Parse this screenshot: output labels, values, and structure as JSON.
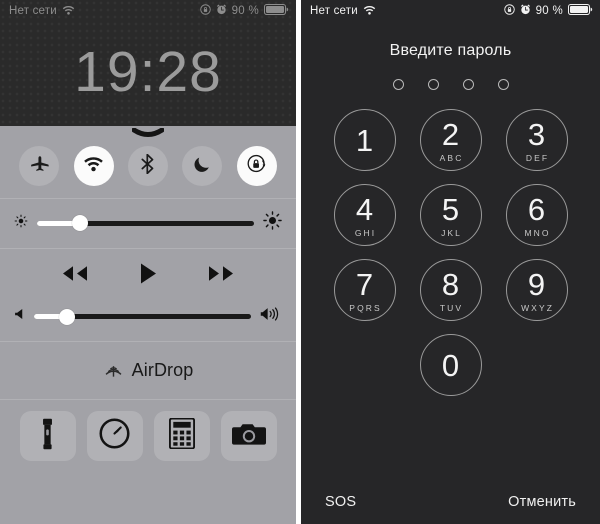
{
  "left": {
    "status_bar": {
      "carrier": "Нет сети",
      "wifi_icon": "wifi-icon",
      "rotation_lock_icon": "rotation-lock-icon",
      "alarm_icon": "alarm-clock-icon",
      "battery_percent": "90 %",
      "battery_icon": "battery-icon",
      "text_color": "#8d8d8d"
    },
    "clock": "19:28",
    "grabber_icon": "chevron-down-grabber-icon",
    "toggles": [
      {
        "name": "airplane-mode",
        "icon": "airplane-icon",
        "state": "off"
      },
      {
        "name": "wifi",
        "icon": "wifi-icon",
        "state": "on"
      },
      {
        "name": "bluetooth",
        "icon": "bluetooth-icon",
        "state": "off"
      },
      {
        "name": "do-not-disturb",
        "icon": "moon-icon",
        "state": "off"
      },
      {
        "name": "rotation-lock",
        "icon": "rotation-lock-icon",
        "state": "on"
      }
    ],
    "brightness": {
      "value_percent": 20,
      "low_icon": "sun-small-icon",
      "high_icon": "sun-large-icon"
    },
    "media": {
      "rewind_icon": "rewind-icon",
      "play_icon": "play-icon",
      "forward_icon": "fast-forward-icon"
    },
    "volume": {
      "value_percent": 15,
      "mute_icon": "speaker-low-icon",
      "max_icon": "speaker-high-icon"
    },
    "airdrop": {
      "label": "AirDrop",
      "icon": "airdrop-icon"
    },
    "shortcuts": [
      {
        "name": "flashlight",
        "icon": "flashlight-icon"
      },
      {
        "name": "timer",
        "icon": "timer-icon"
      },
      {
        "name": "calculator",
        "icon": "calculator-icon"
      },
      {
        "name": "camera",
        "icon": "camera-icon"
      }
    ],
    "colors": {
      "panel_bg": "#a2a2a7",
      "wallpaper_bg": "#2a2a2a",
      "slider_track": "#191919"
    }
  },
  "right": {
    "status_bar": {
      "carrier": "Нет сети",
      "wifi_icon": "wifi-icon",
      "rotation_lock_icon": "rotation-lock-icon",
      "alarm_icon": "alarm-clock-icon",
      "battery_percent": "90 %",
      "battery_icon": "battery-icon",
      "text_color": "#f2f2f2"
    },
    "title": "Введите пароль",
    "passcode_dots": {
      "total": 4,
      "filled": 0
    },
    "keypad": [
      {
        "num": "1",
        "letters": ""
      },
      {
        "num": "2",
        "letters": "ABC"
      },
      {
        "num": "3",
        "letters": "DEF"
      },
      {
        "num": "4",
        "letters": "GHI"
      },
      {
        "num": "5",
        "letters": "JKL"
      },
      {
        "num": "6",
        "letters": "MNO"
      },
      {
        "num": "7",
        "letters": "PQRS"
      },
      {
        "num": "8",
        "letters": "TUV"
      },
      {
        "num": "9",
        "letters": "WXYZ"
      },
      {
        "num": "0",
        "letters": ""
      }
    ],
    "sos_label": "SOS",
    "cancel_label": "Отменить",
    "colors": {
      "panel_bg": "#262628",
      "key_border": "#9a9a9a",
      "text": "#f4f4f4"
    }
  }
}
